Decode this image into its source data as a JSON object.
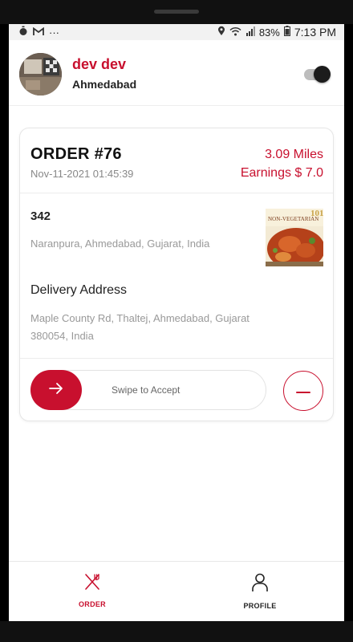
{
  "status_bar": {
    "time": "7:13 PM",
    "battery": "83%",
    "left_icons": [
      "stopwatch-icon",
      "gmail-icon",
      "more-dots-icon"
    ],
    "right_icons": [
      "location-icon",
      "wifi-icon",
      "signal-icon",
      "battery-icon"
    ],
    "dots": "···"
  },
  "profile": {
    "name": "dev dev",
    "city": "Ahmedabad",
    "online_toggle": "on"
  },
  "order": {
    "title": "ORDER #76",
    "datetime": "Nov-11-2021 01:45:39",
    "distance": "3.09 Miles",
    "earnings": "Earnings $ 7.0",
    "restaurant": {
      "name": "342",
      "address": "Naranpura, Ahmedabad, Gujarat, India",
      "thumb_text": "NON-VEGETARIAN"
    },
    "delivery": {
      "label": "Delivery Address",
      "address": "Maple County Rd, Thaltej, Ahmedabad, Gujarat 380054, India"
    },
    "swipe_label": "Swipe to Accept"
  },
  "nav": {
    "order_label": "ORDER",
    "profile_label": "PROFILE"
  },
  "colors": {
    "accent": "#c8102e",
    "text_dark": "#222222",
    "text_muted": "#999999"
  }
}
